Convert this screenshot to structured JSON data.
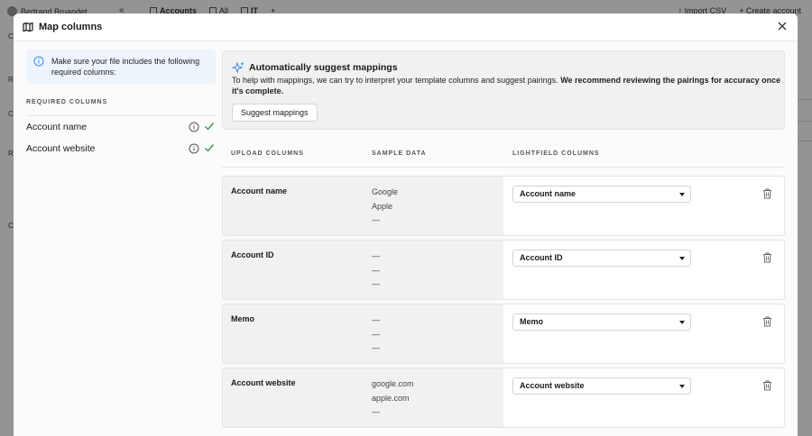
{
  "background": {
    "user_name": "Bertrand Bruandet",
    "tabs": [
      {
        "label": "Accounts"
      },
      {
        "label": "All"
      },
      {
        "label": "IT"
      }
    ],
    "add_tab": "+",
    "import_label": "Import CSV",
    "create_label": "Create account",
    "sidebar_letters": [
      "C",
      "R",
      "C",
      "R",
      "C"
    ]
  },
  "modal": {
    "title": "Map columns",
    "close_icon": "close-icon",
    "notice": "Make sure your file includes the following required columns:",
    "required_heading": "REQUIRED COLUMNS",
    "required": [
      {
        "label": "Account name"
      },
      {
        "label": "Account website"
      }
    ],
    "suggest": {
      "title": "Automatically suggest mappings",
      "desc_plain": "To help with mappings, we can try to interpret your template columns and suggest pairings. ",
      "desc_bold": "We recommend reviewing the pairings for accuracy once it's complete.",
      "button": "Suggest mappings"
    },
    "columns": {
      "upload": "UPLOAD COLUMNS",
      "sample": "SAMPLE DATA",
      "lightfield": "LIGHTFIELD COLUMNS"
    },
    "rows": [
      {
        "upload": "Account name",
        "samples": [
          "Google",
          "Apple",
          "—"
        ],
        "mapped": "Account name"
      },
      {
        "upload": "Account ID",
        "samples": [
          "—",
          "—",
          "—"
        ],
        "mapped": "Account ID"
      },
      {
        "upload": "Memo",
        "samples": [
          "—",
          "—",
          "—"
        ],
        "mapped": "Memo"
      },
      {
        "upload": "Account website",
        "samples": [
          "google.com",
          "apple.com",
          "—"
        ],
        "mapped": "Account website"
      }
    ],
    "colors": {
      "check": "#2f9e44",
      "info": "#3a8ee6",
      "sparkle": "#3a8ee6"
    }
  }
}
